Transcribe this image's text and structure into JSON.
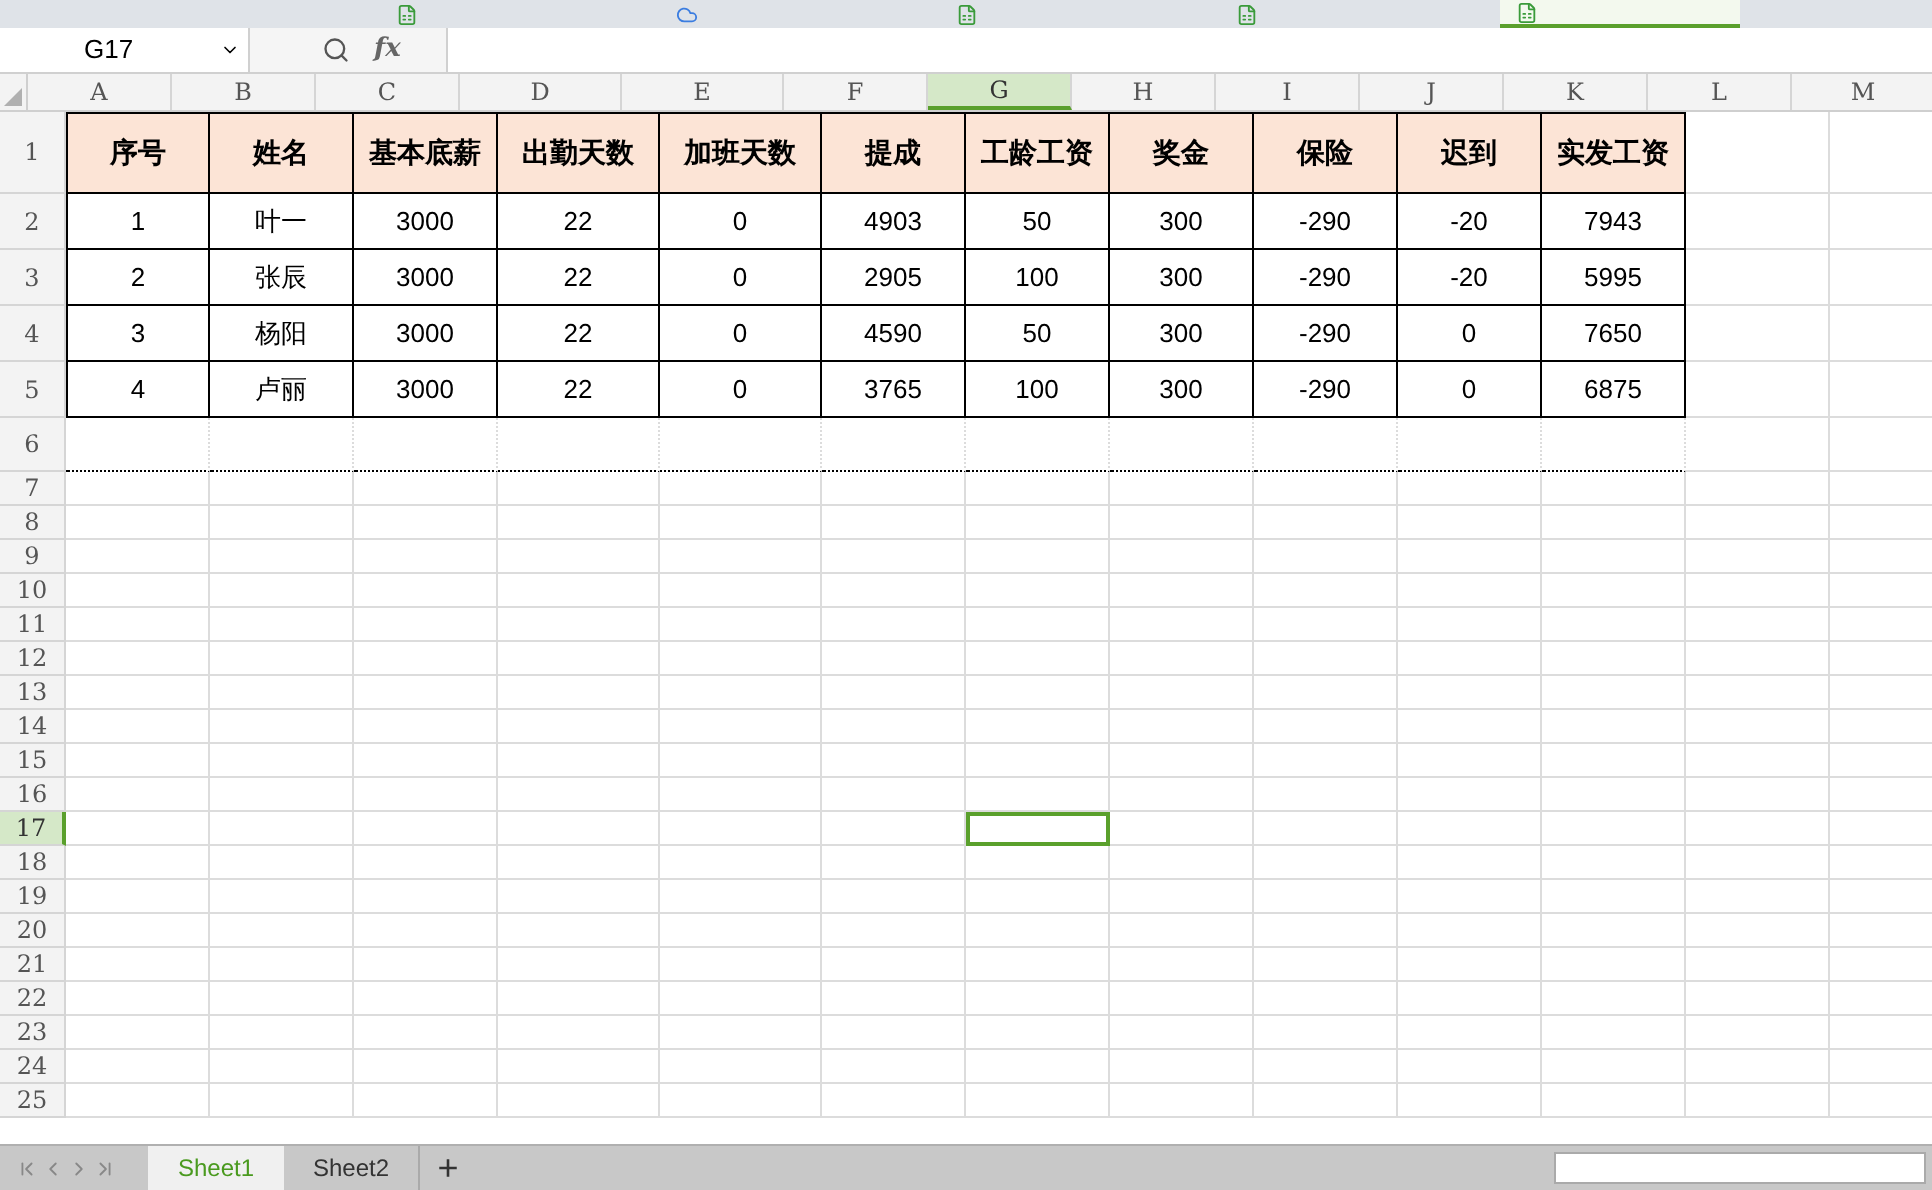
{
  "doc_tabs": [
    {
      "selected": false
    },
    {
      "selected": false
    },
    {
      "selected": false
    },
    {
      "selected": false
    },
    {
      "selected": true
    }
  ],
  "formula_bar": {
    "name_box": "G17",
    "fx": "fx"
  },
  "columns": [
    {
      "label": "A",
      "selected": false
    },
    {
      "label": "B",
      "selected": false
    },
    {
      "label": "C",
      "selected": false
    },
    {
      "label": "D",
      "selected": false
    },
    {
      "label": "E",
      "selected": false
    },
    {
      "label": "F",
      "selected": false
    },
    {
      "label": "G",
      "selected": true
    },
    {
      "label": "H",
      "selected": false
    },
    {
      "label": "I",
      "selected": false
    },
    {
      "label": "J",
      "selected": false
    },
    {
      "label": "K",
      "selected": false
    },
    {
      "label": "L",
      "selected": false
    },
    {
      "label": "M",
      "selected": false
    }
  ],
  "table": {
    "header": [
      "序号",
      "姓名",
      "基本底薪",
      "出勤天数",
      "加班天数",
      "提成",
      "工龄工资",
      "奖金",
      "保险",
      "迟到",
      "实发工资"
    ],
    "rows": [
      [
        "1",
        "叶一",
        "3000",
        "22",
        "0",
        "4903",
        "50",
        "300",
        "-290",
        "-20",
        "7943"
      ],
      [
        "2",
        "张辰",
        "3000",
        "22",
        "0",
        "2905",
        "100",
        "300",
        "-290",
        "-20",
        "5995"
      ],
      [
        "3",
        "杨阳",
        "3000",
        "22",
        "0",
        "4590",
        "50",
        "300",
        "-290",
        "0",
        "7650"
      ],
      [
        "4",
        "卢丽",
        "3000",
        "22",
        "0",
        "3765",
        "100",
        "300",
        "-290",
        "0",
        "6875"
      ]
    ]
  },
  "row_numbers": [
    {
      "label": "1",
      "selected": false
    },
    {
      "label": "2",
      "selected": false
    },
    {
      "label": "3",
      "selected": false
    },
    {
      "label": "4",
      "selected": false
    },
    {
      "label": "5",
      "selected": false
    },
    {
      "label": "6",
      "selected": false
    },
    {
      "label": "7",
      "selected": false
    },
    {
      "label": "8",
      "selected": false
    },
    {
      "label": "9",
      "selected": false
    },
    {
      "label": "10",
      "selected": false
    },
    {
      "label": "11",
      "selected": false
    },
    {
      "label": "12",
      "selected": false
    },
    {
      "label": "13",
      "selected": false
    },
    {
      "label": "14",
      "selected": false
    },
    {
      "label": "15",
      "selected": false
    },
    {
      "label": "16",
      "selected": false
    },
    {
      "label": "17",
      "selected": true
    },
    {
      "label": "18",
      "selected": false
    },
    {
      "label": "19",
      "selected": false
    },
    {
      "label": "20",
      "selected": false
    },
    {
      "label": "21",
      "selected": false
    },
    {
      "label": "22",
      "selected": false
    },
    {
      "label": "23",
      "selected": false
    },
    {
      "label": "24",
      "selected": false
    },
    {
      "label": "25",
      "selected": false
    }
  ],
  "sheets": [
    {
      "label": "Sheet1",
      "selected": true
    },
    {
      "label": "Sheet2",
      "selected": false
    }
  ],
  "add_sheet": "+"
}
